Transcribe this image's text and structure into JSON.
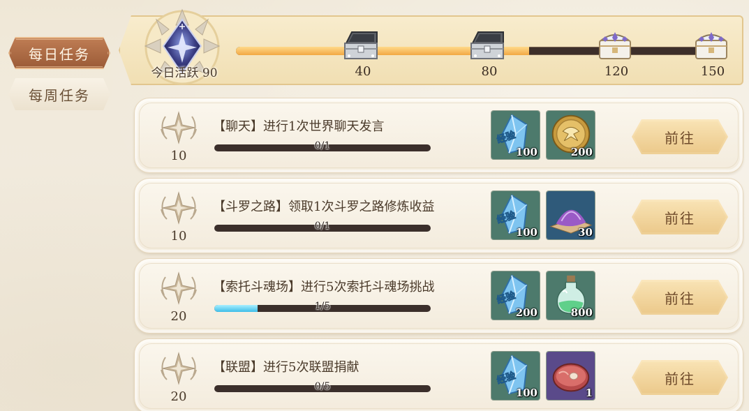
{
  "tabs": {
    "daily": "每日任务",
    "weekly": "每周任务"
  },
  "activity": {
    "label": "今日活跃",
    "value": "90",
    "progress": 0.6,
    "milestones": [
      {
        "value": "40",
        "chest": "silver-chest",
        "opened": true
      },
      {
        "value": "80",
        "chest": "silver-chest",
        "opened": true
      },
      {
        "value": "120",
        "chest": "ornate-chest",
        "opened": false
      },
      {
        "value": "150",
        "chest": "ornate-chest",
        "opened": false
      }
    ]
  },
  "tasks": [
    {
      "points": "10",
      "title": "【聊天】进行1次世界聊天发言",
      "progress_text": "0/1",
      "progress": 0,
      "rewards": [
        {
          "icon": "exp-crystal-icon",
          "label": "经验",
          "count": "100"
        },
        {
          "icon": "gold-coin-icon",
          "count": "200"
        }
      ],
      "button": "前往"
    },
    {
      "points": "10",
      "title": "【斗罗之路】领取1次斗罗之路修炼收益",
      "progress_text": "0/1",
      "progress": 0,
      "rewards": [
        {
          "icon": "exp-crystal-icon",
          "label": "经验",
          "count": "100"
        },
        {
          "icon": "purple-powder-icon",
          "count": "30"
        }
      ],
      "button": "前往"
    },
    {
      "points": "20",
      "title": "【索托斗魂场】进行5次索托斗魂场挑战",
      "progress_text": "1/5",
      "progress": 0.2,
      "rewards": [
        {
          "icon": "exp-crystal-icon",
          "label": "经验",
          "count": "200"
        },
        {
          "icon": "potion-bottle-icon",
          "count": "800"
        }
      ],
      "button": "前往"
    },
    {
      "points": "20",
      "title": "【联盟】进行5次联盟捐献",
      "progress_text": "0/5",
      "progress": 0,
      "rewards": [
        {
          "icon": "exp-crystal-icon",
          "label": "经验",
          "count": "100"
        },
        {
          "icon": "meat-icon",
          "count": "1"
        }
      ],
      "button": "前往"
    }
  ]
}
